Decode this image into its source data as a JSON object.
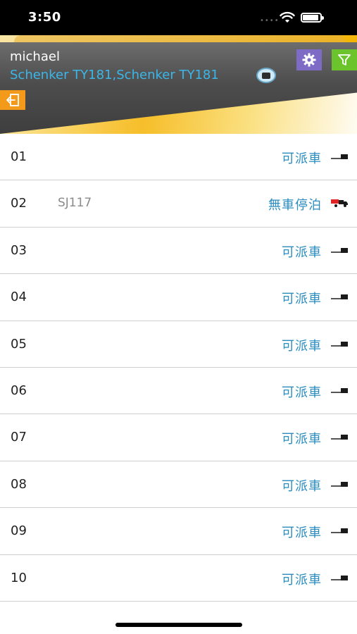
{
  "status_bar": {
    "time": "3:50"
  },
  "header": {
    "user_name": "michael",
    "station": "Schenker TY181,Schenker TY181"
  },
  "bays": [
    {
      "number": "01",
      "plate": "",
      "status": "可派車",
      "icon": "empty-bay-icon"
    },
    {
      "number": "02",
      "plate": "SJ117",
      "status": "無車停泊",
      "icon": "truck-parked-icon"
    },
    {
      "number": "03",
      "plate": "",
      "status": "可派車",
      "icon": "empty-bay-icon"
    },
    {
      "number": "04",
      "plate": "",
      "status": "可派車",
      "icon": "empty-bay-icon"
    },
    {
      "number": "05",
      "plate": "",
      "status": "可派車",
      "icon": "empty-bay-icon"
    },
    {
      "number": "06",
      "plate": "",
      "status": "可派車",
      "icon": "empty-bay-icon"
    },
    {
      "number": "07",
      "plate": "",
      "status": "可派車",
      "icon": "empty-bay-icon"
    },
    {
      "number": "08",
      "plate": "",
      "status": "可派車",
      "icon": "empty-bay-icon"
    },
    {
      "number": "09",
      "plate": "",
      "status": "可派車",
      "icon": "empty-bay-icon"
    },
    {
      "number": "10",
      "plate": "",
      "status": "可派車",
      "icon": "empty-bay-icon"
    }
  ],
  "colors": {
    "settings_button": "#7d6bc6",
    "filter_button": "#6cc42d",
    "logout_button": "#f39a1b",
    "status_text": "#2a8cbf",
    "station_text": "#3ab7e8"
  }
}
